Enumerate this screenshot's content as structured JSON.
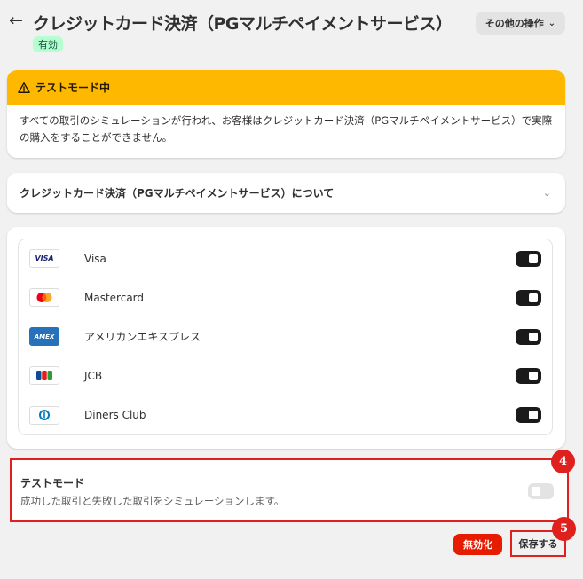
{
  "header": {
    "title": "クレジットカード決済（PGマルチペイメントサービス）",
    "status_badge": "有効",
    "more_actions_label": "その他の操作"
  },
  "test_mode_banner": {
    "title": "テストモード中",
    "body": "すべての取引のシミュレーションが行われ、お客様はクレジットカード決済（PGマルチペイメントサービス）で実際の購入をすることができません。"
  },
  "about_section": {
    "title": "クレジットカード決済（PGマルチペイメントサービス）について"
  },
  "card_brands": [
    {
      "name": "Visa",
      "logo": "visa-logo",
      "logo_text": "VISA",
      "enabled": true
    },
    {
      "name": "Mastercard",
      "logo": "mastercard-logo",
      "enabled": true
    },
    {
      "name": "アメリカンエキスプレス",
      "logo": "amex-logo",
      "logo_text": "AMEX",
      "enabled": true
    },
    {
      "name": "JCB",
      "logo": "jcb-logo",
      "enabled": true
    },
    {
      "name": "Diners Club",
      "logo": "diners-club-logo",
      "enabled": true
    }
  ],
  "test_mode": {
    "title": "テストモード",
    "description": "成功した取引と失敗した取引をシミュレーションします。",
    "enabled": false
  },
  "annotations": {
    "step_4": "4",
    "step_5": "5"
  },
  "actions": {
    "deactivate_label": "無効化",
    "save_label": "保存する"
  },
  "colors": {
    "warning": "#ffb800",
    "critical": "#e51c00",
    "annotation": "#e0201c",
    "badge_success": "#b4fed2"
  }
}
